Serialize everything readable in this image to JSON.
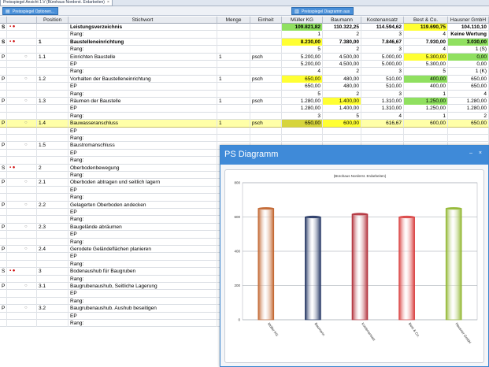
{
  "window": {
    "tab_title": "Preisspiegel Ansicht 1.V (Bürohaus Norderst. Erdarbeiten)",
    "tab_close": "×"
  },
  "toolbar": {
    "options_label": "Preisspiegel Optionen...",
    "diagram_label": "Preisspiegel Diagramm aus"
  },
  "columns": [
    "",
    "",
    "Position",
    "Stichwort",
    "Menge",
    "Einheit",
    "Müller KG",
    "Baumann",
    "Kostenansatz",
    "Best & Co.",
    "Hausner GmbH"
  ],
  "rows": [
    {
      "t": "S",
      "m": "▪ ●",
      "pos": "",
      "text": "Leistungsverzeichnis",
      "menge": "",
      "einh": "",
      "v": [
        "109.821,82",
        "110.322,25",
        "114.594,62",
        "119.690,75",
        "104.110,10"
      ],
      "hl": [
        "green",
        "",
        "",
        "yellow",
        ""
      ],
      "bold": true
    },
    {
      "t": "",
      "m": "",
      "pos": "",
      "text": "Rang:",
      "menge": "",
      "einh": "",
      "v": [
        "1",
        "2",
        "3",
        "4",
        "Keine Wertung"
      ],
      "hl": [
        "",
        "",
        "",
        "",
        ""
      ],
      "bold": false,
      "lastbold": true
    },
    {
      "t": "S",
      "m": "▪ ●",
      "pos": "1",
      "text": "Baustelleneinrichtung",
      "menge": "",
      "einh": "",
      "v": [
        "8.230,00",
        "7.380,00",
        "7.846,67",
        "7.930,00",
        "3.030,00"
      ],
      "hl": [
        "yellow",
        "",
        "",
        "",
        "green"
      ],
      "bold": true
    },
    {
      "t": "",
      "m": "",
      "pos": "",
      "text": "Rang:",
      "menge": "",
      "einh": "",
      "v": [
        "5",
        "2",
        "3",
        "4",
        "1 (S)"
      ],
      "hl": [
        "",
        "",
        "",
        "",
        ""
      ],
      "bold": false
    },
    {
      "t": "P",
      "m": "○",
      "pos": "1.1",
      "text": "Einrichten Baustelle",
      "menge": "1",
      "einh": "psch",
      "v": [
        "5.200,00",
        "4.500,00",
        "5.000,00",
        "5.300,00",
        "0,00"
      ],
      "hl": [
        "",
        "",
        "",
        "yellow",
        "green"
      ],
      "bold": false
    },
    {
      "t": "",
      "m": "",
      "pos": "",
      "text": "EP",
      "menge": "",
      "einh": "",
      "v": [
        "5.200,00",
        "4.500,00",
        "5.000,00",
        "5.300,00",
        "0,00"
      ],
      "hl": [
        "",
        "",
        "",
        "",
        ""
      ],
      "bold": false
    },
    {
      "t": "",
      "m": "",
      "pos": "",
      "text": "Rang:",
      "menge": "",
      "einh": "",
      "v": [
        "4",
        "2",
        "3",
        "5",
        "1 (K)"
      ],
      "hl": [
        "",
        "",
        "",
        "",
        ""
      ],
      "bold": false
    },
    {
      "t": "P",
      "m": "○",
      "pos": "1.2",
      "text": "Vorhalten der Baustelleneinrichtung",
      "menge": "1",
      "einh": "psch",
      "v": [
        "650,00",
        "480,00",
        "510,00",
        "400,00",
        "650,00"
      ],
      "hl": [
        "yellow",
        "",
        "",
        "green",
        ""
      ],
      "bold": false
    },
    {
      "t": "",
      "m": "",
      "pos": "",
      "text": "EP",
      "menge": "",
      "einh": "",
      "v": [
        "650,00",
        "480,00",
        "510,00",
        "400,00",
        "650,00"
      ],
      "hl": [
        "",
        "",
        "",
        "",
        ""
      ],
      "bold": false
    },
    {
      "t": "",
      "m": "",
      "pos": "",
      "text": "Rang:",
      "menge": "",
      "einh": "",
      "v": [
        "5",
        "2",
        "3",
        "1",
        "4"
      ],
      "hl": [
        "",
        "",
        "",
        "",
        ""
      ],
      "bold": false
    },
    {
      "t": "P",
      "m": "○",
      "pos": "1.3",
      "text": "Räumen der Baustelle",
      "menge": "1",
      "einh": "psch",
      "v": [
        "1.280,00",
        "1.400,00",
        "1.310,00",
        "1.250,00",
        "1.280,00"
      ],
      "hl": [
        "",
        "yellow",
        "",
        "green",
        ""
      ],
      "bold": false
    },
    {
      "t": "",
      "m": "",
      "pos": "",
      "text": "EP",
      "menge": "",
      "einh": "",
      "v": [
        "1.280,00",
        "1.400,00",
        "1.310,00",
        "1.250,00",
        "1.280,00"
      ],
      "hl": [
        "",
        "",
        "",
        "",
        ""
      ],
      "bold": false
    },
    {
      "t": "",
      "m": "",
      "pos": "",
      "text": "Rang:",
      "menge": "",
      "einh": "",
      "v": [
        "3",
        "5",
        "4",
        "1",
        "2"
      ],
      "hl": [
        "",
        "",
        "",
        "",
        ""
      ],
      "bold": false
    },
    {
      "t": "P",
      "m": "○",
      "pos": "1.4",
      "text": "Bauwasseranschluss",
      "menge": "1",
      "einh": "psch",
      "v": [
        "650,00",
        "600,00",
        "616,67",
        "600,00",
        "650,00"
      ],
      "hl": [
        "olive",
        "yellow",
        "",
        "",
        ""
      ],
      "bold": false,
      "sel": true
    },
    {
      "t": "",
      "m": "",
      "pos": "",
      "text": "EP",
      "menge": "",
      "einh": "",
      "v": [
        "",
        "",
        "",
        "",
        ""
      ],
      "hl": [
        "",
        "",
        "",
        "",
        ""
      ],
      "bold": false
    },
    {
      "t": "",
      "m": "",
      "pos": "",
      "text": "Rang:",
      "menge": "",
      "einh": "",
      "v": [
        "",
        "",
        "",
        "",
        ""
      ],
      "hl": [
        "",
        "",
        "",
        "",
        ""
      ],
      "bold": false
    },
    {
      "t": "P",
      "m": "○",
      "pos": "1.5",
      "text": "Baustromanschluss",
      "menge": "",
      "einh": "",
      "v": [
        "",
        "",
        "",
        "",
        ""
      ],
      "hl": [
        "",
        "",
        "",
        "",
        ""
      ],
      "bold": false
    },
    {
      "t": "",
      "m": "",
      "pos": "",
      "text": "EP",
      "menge": "",
      "einh": "",
      "v": [
        "",
        "",
        "",
        "",
        ""
      ],
      "hl": [
        "",
        "",
        "",
        "",
        ""
      ],
      "bold": false
    },
    {
      "t": "",
      "m": "",
      "pos": "",
      "text": "Rang:",
      "menge": "",
      "einh": "",
      "v": [
        "",
        "",
        "",
        "",
        ""
      ],
      "hl": [
        "",
        "",
        "",
        "",
        ""
      ],
      "bold": false
    },
    {
      "t": "S",
      "m": "▪ ●",
      "pos": "2",
      "text": "Oberbodenbewegung",
      "menge": "",
      "einh": "",
      "v": [
        "",
        "",
        "",
        "",
        ""
      ],
      "hl": [
        "",
        "",
        "",
        "",
        ""
      ],
      "bold": false
    },
    {
      "t": "",
      "m": "",
      "pos": "",
      "text": "Rang:",
      "menge": "",
      "einh": "",
      "v": [
        "",
        "",
        "",
        "",
        ""
      ],
      "hl": [
        "",
        "",
        "",
        "",
        ""
      ],
      "bold": false
    },
    {
      "t": "P",
      "m": "○",
      "pos": "2.1",
      "text": "Oberboden abtragen und seitlich lagern",
      "menge": "",
      "einh": "",
      "v": [
        "",
        "",
        "",
        "",
        ""
      ],
      "hl": [
        "",
        "",
        "",
        "",
        ""
      ],
      "bold": false
    },
    {
      "t": "",
      "m": "",
      "pos": "",
      "text": "EP",
      "menge": "",
      "einh": "",
      "v": [
        "",
        "",
        "",
        "",
        ""
      ],
      "hl": [
        "",
        "",
        "",
        "",
        ""
      ],
      "bold": false
    },
    {
      "t": "",
      "m": "",
      "pos": "",
      "text": "Rang:",
      "menge": "",
      "einh": "",
      "v": [
        "",
        "",
        "",
        "",
        ""
      ],
      "hl": [
        "",
        "",
        "",
        "",
        ""
      ],
      "bold": false
    },
    {
      "t": "P",
      "m": "○",
      "pos": "2.2",
      "text": "Gelagerten Oberboden andecken",
      "menge": "",
      "einh": "",
      "v": [
        "",
        "",
        "",
        "",
        ""
      ],
      "hl": [
        "",
        "",
        "",
        "",
        ""
      ],
      "bold": false
    },
    {
      "t": "",
      "m": "",
      "pos": "",
      "text": "EP",
      "menge": "",
      "einh": "",
      "v": [
        "",
        "",
        "",
        "",
        ""
      ],
      "hl": [
        "",
        "",
        "",
        "",
        ""
      ],
      "bold": false
    },
    {
      "t": "",
      "m": "",
      "pos": "",
      "text": "Rang:",
      "menge": "",
      "einh": "",
      "v": [
        "",
        "",
        "",
        "",
        ""
      ],
      "hl": [
        "",
        "",
        "",
        "",
        ""
      ],
      "bold": false
    },
    {
      "t": "P",
      "m": "○",
      "pos": "2.3",
      "text": "Baugelände abräumen",
      "menge": "",
      "einh": "",
      "v": [
        "",
        "",
        "",
        "",
        ""
      ],
      "hl": [
        "",
        "",
        "",
        "",
        ""
      ],
      "bold": false
    },
    {
      "t": "",
      "m": "",
      "pos": "",
      "text": "EP",
      "menge": "",
      "einh": "",
      "v": [
        "",
        "",
        "",
        "",
        ""
      ],
      "hl": [
        "",
        "",
        "",
        "",
        ""
      ],
      "bold": false
    },
    {
      "t": "",
      "m": "",
      "pos": "",
      "text": "Rang:",
      "menge": "",
      "einh": "",
      "v": [
        "",
        "",
        "",
        "",
        ""
      ],
      "hl": [
        "",
        "",
        "",
        "",
        ""
      ],
      "bold": false
    },
    {
      "t": "P",
      "m": "○",
      "pos": "2.4",
      "text": "Gerodete Geländeflächen planieren",
      "menge": "",
      "einh": "",
      "v": [
        "",
        "",
        "",
        "",
        ""
      ],
      "hl": [
        "",
        "",
        "",
        "",
        ""
      ],
      "bold": false
    },
    {
      "t": "",
      "m": "",
      "pos": "",
      "text": "EP",
      "menge": "",
      "einh": "",
      "v": [
        "",
        "",
        "",
        "",
        ""
      ],
      "hl": [
        "",
        "",
        "",
        "",
        ""
      ],
      "bold": false
    },
    {
      "t": "",
      "m": "",
      "pos": "",
      "text": "Rang:",
      "menge": "",
      "einh": "",
      "v": [
        "",
        "",
        "",
        "",
        ""
      ],
      "hl": [
        "",
        "",
        "",
        "",
        ""
      ],
      "bold": false
    },
    {
      "t": "S",
      "m": "▪ ●",
      "pos": "3",
      "text": "Bodenaushub für Baugruben",
      "menge": "",
      "einh": "",
      "v": [
        "",
        "",
        "",
        "",
        ""
      ],
      "hl": [
        "",
        "",
        "",
        "",
        ""
      ],
      "bold": false
    },
    {
      "t": "",
      "m": "",
      "pos": "",
      "text": "Rang:",
      "menge": "",
      "einh": "",
      "v": [
        "",
        "",
        "",
        "",
        ""
      ],
      "hl": [
        "",
        "",
        "",
        "",
        ""
      ],
      "bold": false
    },
    {
      "t": "P",
      "m": "○",
      "pos": "3.1",
      "text": "Baugrubenaushub, Seitliche Lagerung",
      "menge": "",
      "einh": "",
      "v": [
        "",
        "",
        "",
        "",
        ""
      ],
      "hl": [
        "",
        "",
        "",
        "",
        ""
      ],
      "bold": false
    },
    {
      "t": "",
      "m": "",
      "pos": "",
      "text": "EP",
      "menge": "",
      "einh": "",
      "v": [
        "",
        "",
        "",
        "",
        ""
      ],
      "hl": [
        "",
        "",
        "",
        "",
        ""
      ],
      "bold": false
    },
    {
      "t": "",
      "m": "",
      "pos": "",
      "text": "Rang:",
      "menge": "",
      "einh": "",
      "v": [
        "",
        "",
        "",
        "",
        ""
      ],
      "hl": [
        "",
        "",
        "",
        "",
        ""
      ],
      "bold": false
    },
    {
      "t": "P",
      "m": "○",
      "pos": "3.2",
      "text": "Baugrubenaushub. Aushub beseitigen",
      "menge": "",
      "einh": "",
      "v": [
        "",
        "",
        "",
        "",
        ""
      ],
      "hl": [
        "",
        "",
        "",
        "",
        ""
      ],
      "bold": false
    },
    {
      "t": "",
      "m": "",
      "pos": "",
      "text": "EP",
      "menge": "",
      "einh": "",
      "v": [
        "",
        "",
        "",
        "",
        ""
      ],
      "hl": [
        "",
        "",
        "",
        "",
        ""
      ],
      "bold": false
    },
    {
      "t": "",
      "m": "",
      "pos": "",
      "text": "Rang:",
      "menge": "",
      "einh": "",
      "v": [
        "",
        "",
        "",
        "",
        ""
      ],
      "hl": [
        "",
        "",
        "",
        "",
        ""
      ],
      "bold": false
    }
  ],
  "diagram": {
    "title": "PS Diagramm",
    "controls": "– ×"
  },
  "chart_data": {
    "type": "bar",
    "title": "(Bürohaus Norderst. Erdarbeiten)",
    "categories": [
      "Müller KG",
      "Baumann",
      "Kostenansatz",
      "Best & Co.",
      "Hausner GmbH"
    ],
    "values": [
      650,
      600,
      616.67,
      600,
      650
    ],
    "colors": [
      "#c0622a",
      "#1c2f5e",
      "#b02c36",
      "#d83a3a",
      "#8fb52c"
    ],
    "ylim": [
      0,
      800
    ],
    "yticks": [
      "0",
      "200",
      "400",
      "600",
      "800"
    ],
    "grid": true
  },
  "colors": {
    "highlight_yellow": "#ffff33",
    "highlight_green": "#90e060",
    "selection": "#ffffa8",
    "diagram_header": "#3f8ad8"
  }
}
